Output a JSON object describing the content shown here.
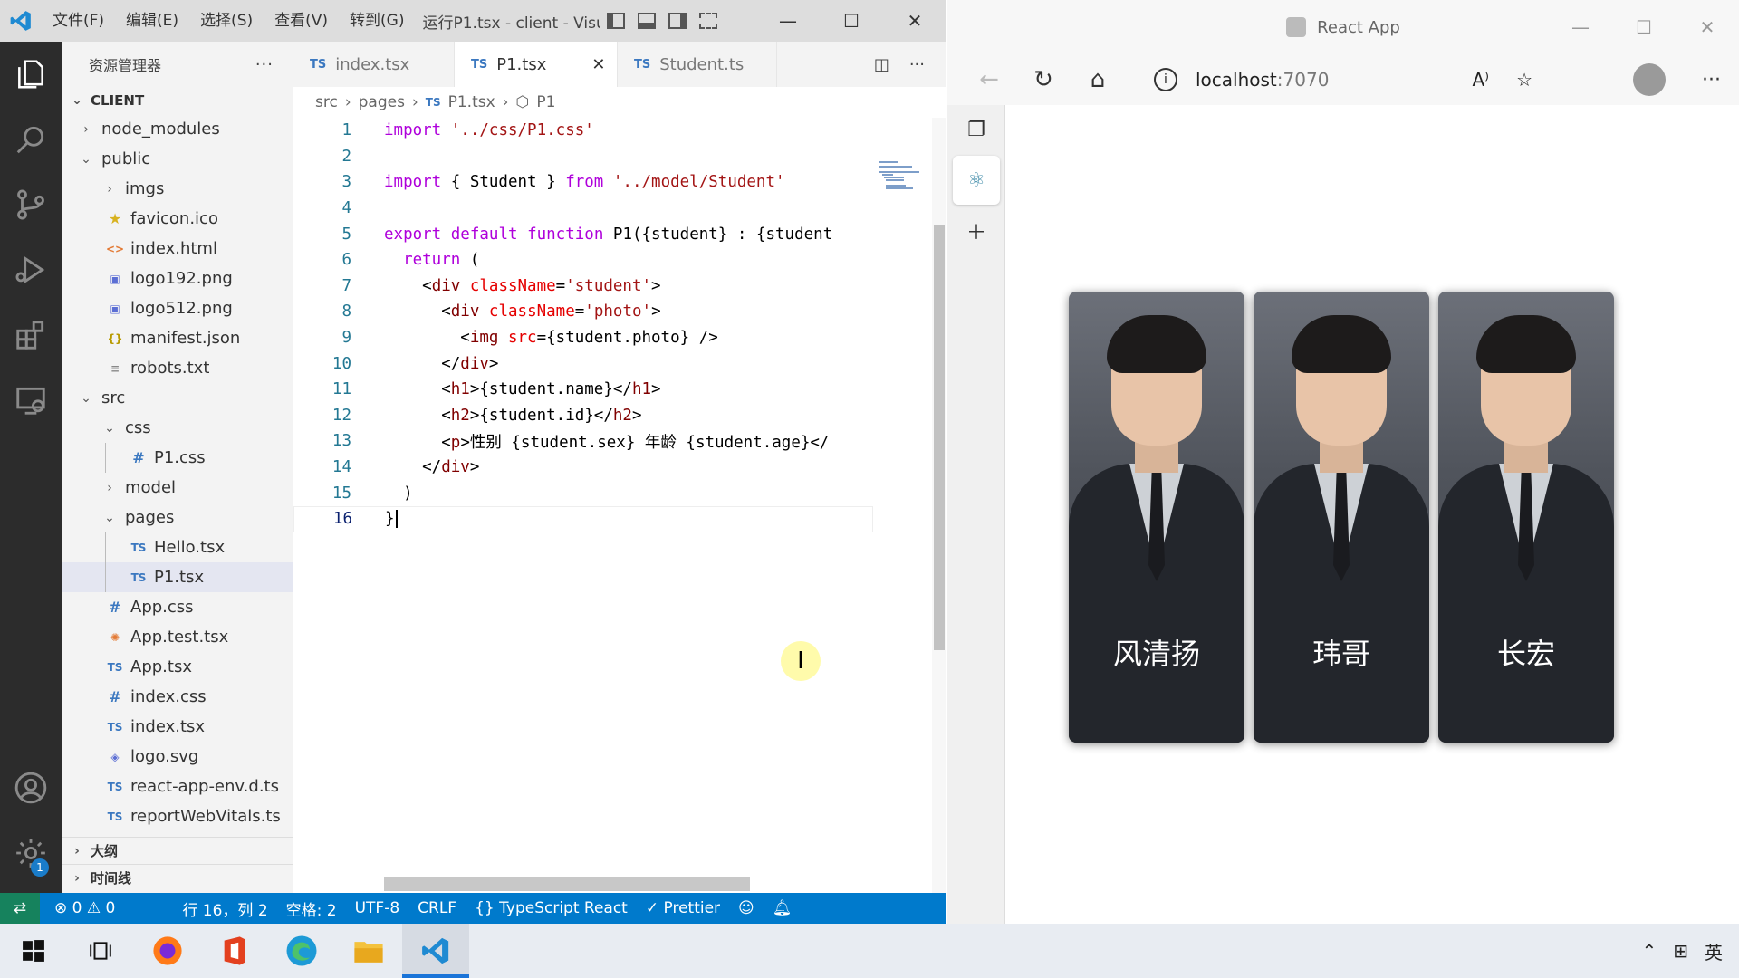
{
  "vscode": {
    "menu": [
      "文件(F)",
      "编辑(E)",
      "选择(S)",
      "查看(V)",
      "转到(G)"
    ],
    "window_title": "运行P1.tsx - client - Visu...",
    "explorer_title": "资源管理器",
    "root_folder": "CLIENT",
    "tree": [
      {
        "label": "node_modules",
        "type": "folder",
        "level": 1,
        "open": false
      },
      {
        "label": "public",
        "type": "folder",
        "level": 1,
        "open": true
      },
      {
        "label": "imgs",
        "type": "folder",
        "level": 2,
        "open": false
      },
      {
        "label": "favicon.ico",
        "type": "star",
        "level": 2
      },
      {
        "label": "index.html",
        "type": "html",
        "level": 2
      },
      {
        "label": "logo192.png",
        "type": "img",
        "level": 2
      },
      {
        "label": "logo512.png",
        "type": "img",
        "level": 2
      },
      {
        "label": "manifest.json",
        "type": "json",
        "level": 2
      },
      {
        "label": "robots.txt",
        "type": "txt",
        "level": 2
      },
      {
        "label": "src",
        "type": "folder",
        "level": 1,
        "open": true
      },
      {
        "label": "css",
        "type": "folder",
        "level": 2,
        "open": true
      },
      {
        "label": "P1.css",
        "type": "css",
        "level": 3
      },
      {
        "label": "model",
        "type": "folder",
        "level": 2,
        "open": false
      },
      {
        "label": "pages",
        "type": "folder",
        "level": 2,
        "open": true
      },
      {
        "label": "Hello.tsx",
        "type": "ts",
        "level": 3
      },
      {
        "label": "P1.tsx",
        "type": "ts",
        "level": 3,
        "selected": true
      },
      {
        "label": "App.css",
        "type": "css",
        "level": 2
      },
      {
        "label": "App.test.tsx",
        "type": "test",
        "level": 2
      },
      {
        "label": "App.tsx",
        "type": "ts",
        "level": 2
      },
      {
        "label": "index.css",
        "type": "css",
        "level": 2
      },
      {
        "label": "index.tsx",
        "type": "ts",
        "level": 2
      },
      {
        "label": "logo.svg",
        "type": "svg",
        "level": 2
      },
      {
        "label": "react-app-env.d.ts",
        "type": "ts",
        "level": 2
      },
      {
        "label": "reportWebVitals.ts",
        "type": "ts",
        "level": 2
      }
    ],
    "outline_label": "大纲",
    "timeline_label": "时间线",
    "tabs": [
      {
        "label": "index.tsx",
        "active": false
      },
      {
        "label": "P1.tsx",
        "active": true
      },
      {
        "label": "Student.ts",
        "active": false
      }
    ],
    "breadcrumbs": [
      "src",
      "pages",
      "P1.tsx",
      "P1"
    ],
    "code_lines": [
      "import '../css/P1.css'",
      "",
      "import { Student } from '../model/Student'",
      "",
      "export default function P1({student} : {student",
      "  return (",
      "    <div className='student'>",
      "      <div className='photo'>",
      "        <img src={student.photo} />",
      "      </div>",
      "      <h1>{student.name}</h1>",
      "      <h2>{student.id}</h2>",
      "      <p>性别 {student.sex} 年龄 {student.age}</",
      "    </div>",
      "  )",
      "}"
    ],
    "status": {
      "errors": "0",
      "warnings": "0",
      "position": "行 16，列 2",
      "spaces": "空格: 2",
      "encoding": "UTF-8",
      "eol": "CRLF",
      "language": "TypeScript React",
      "formatter": "Prettier"
    },
    "settings_badge": "1"
  },
  "browser": {
    "title": "React App",
    "url_host": "localhost",
    "url_port": ":7070",
    "students": [
      {
        "name": "风清扬"
      },
      {
        "name": "玮哥"
      },
      {
        "name": "长宏"
      }
    ]
  },
  "taskbar": {
    "apps": [
      "windows-start",
      "task-view",
      "firefox",
      "office",
      "edge",
      "file-explorer",
      "vscode"
    ],
    "ime": "英"
  },
  "colors": {
    "statusbar": "#007acc",
    "activitybar": "#2c2c2c",
    "keyword": "#0000ff",
    "control_keyword": "#af00db",
    "string": "#a31515",
    "tag": "#800000",
    "attribute": "#e50000"
  }
}
